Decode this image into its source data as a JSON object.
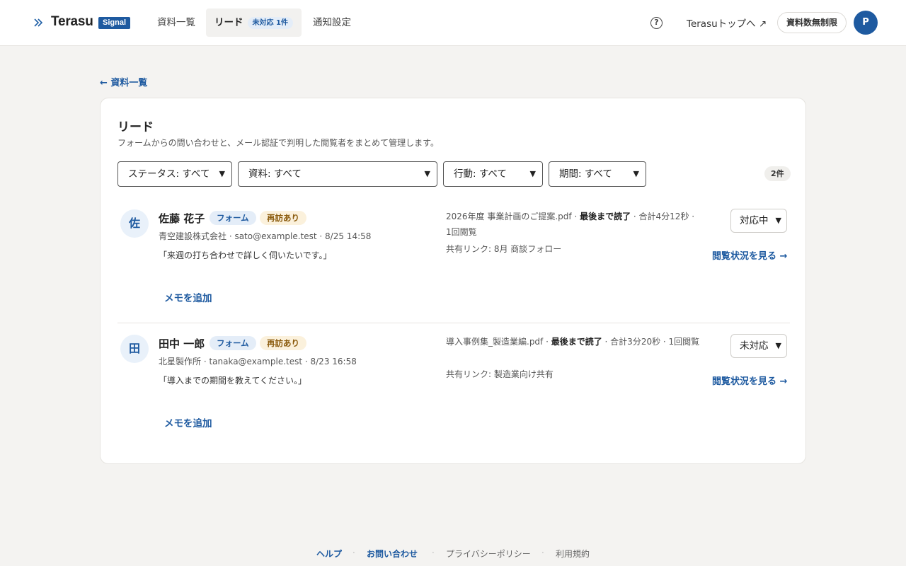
{
  "header": {
    "brand": "Terasu",
    "badge": "Signal",
    "nav": [
      {
        "label": "資料一覧"
      },
      {
        "label": "リード",
        "badge": "未対応 1件"
      },
      {
        "label": "通知設定"
      }
    ],
    "top_link": "Terasuトップへ ↗",
    "plan": "資料数無制限",
    "avatar": "P",
    "expand_icon": "double-chevron-right-icon",
    "help_icon": "question-circle-icon"
  },
  "back_link": "← 資料一覧",
  "page": {
    "title": "リード",
    "description": "フォームからの問い合わせと、メール認証で判明した閲覧者をまとめて管理します。",
    "filters": {
      "status": "ステータス: すべて",
      "document": "資料: すべて",
      "action": "行動: すべて",
      "period": "期間: すべて"
    },
    "count": "2件"
  },
  "leads": [
    {
      "initial": "佐",
      "name": "佐藤 花子",
      "tags": [
        "フォーム",
        "再訪あり"
      ],
      "meta": "青空建設株式会社 · sato@example.test · 8/25 14:58",
      "quote": "「来週の打ち合わせで詳しく伺いたいです。」",
      "memo": "メモを追加",
      "doc_name": "2026年度 事業計画のご提案.pdf · ",
      "doc_bold": "最後まで読了",
      "doc_rest": " · 合計4分12秒 · 1回閲覧",
      "share": "共有リンク: 8月 商談フォロー",
      "status": "対応中",
      "view": "閲覧状況を見る →"
    },
    {
      "initial": "田",
      "name": "田中 一郎",
      "tags": [
        "フォーム",
        "再訪あり"
      ],
      "meta": "北星製作所 · tanaka@example.test · 8/23 16:58",
      "quote": "「導入までの期間を教えてください。」",
      "memo": "メモを追加",
      "doc_name": "導入事例集_製造業編.pdf · ",
      "doc_bold": "最後まで読了",
      "doc_rest": " · 合計3分20秒 · 1回閲覧",
      "share": "共有リンク: 製造業向け共有",
      "status": "未対応",
      "view": "閲覧状況を見る →"
    }
  ],
  "footer": {
    "help": "ヘルプ",
    "contact": "お問い合わせ",
    "privacy": "プライバシーポリシー",
    "terms": "利用規約"
  },
  "colors": {
    "accent": "#1e5aa0",
    "background": "#f4f3f1",
    "revisit_bg": "#fbf1dc"
  }
}
